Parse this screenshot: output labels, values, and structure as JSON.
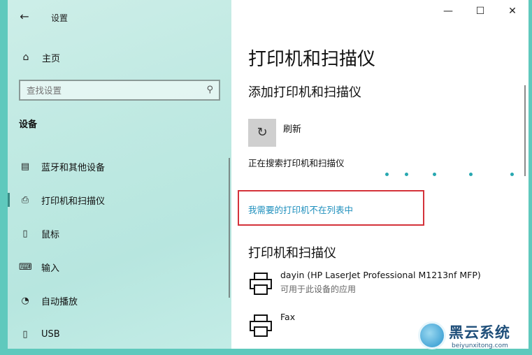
{
  "window": {
    "title": "设置"
  },
  "sidebar": {
    "home_label": "主页",
    "search": {
      "placeholder": "查找设置"
    },
    "section": "设备",
    "items": [
      {
        "label": "蓝牙和其他设备",
        "icon": "bluetooth-devices-icon"
      },
      {
        "label": "打印机和扫描仪",
        "icon": "printer-icon",
        "active": true
      },
      {
        "label": "鼠标",
        "icon": "mouse-icon"
      },
      {
        "label": "输入",
        "icon": "keyboard-icon"
      },
      {
        "label": "自动播放",
        "icon": "autoplay-icon"
      },
      {
        "label": "USB",
        "icon": "usb-icon"
      }
    ]
  },
  "titlebar": {
    "minimize": "—",
    "maximize": "☐",
    "close": "✕"
  },
  "main": {
    "page_title": "打印机和扫描仪",
    "add_section": "添加打印机和扫描仪",
    "refresh_label": "刷新",
    "searching_text": "正在搜索打印机和扫描仪",
    "not_listed_link": "我需要的打印机不在列表中",
    "printers_section": "打印机和扫描仪",
    "printers": [
      {
        "name": "dayin (HP LaserJet Professional M1213nf MFP)",
        "desc": "可用于此设备的应用"
      },
      {
        "name": "Fax",
        "desc": ""
      }
    ]
  },
  "watermark": {
    "brand": "黑云系统",
    "url": "beiyunxitong.com"
  },
  "colors": {
    "accent": "#1e8fbd",
    "highlight_box": "#d4323a",
    "sidebar_bg": "#bfe9e2"
  }
}
